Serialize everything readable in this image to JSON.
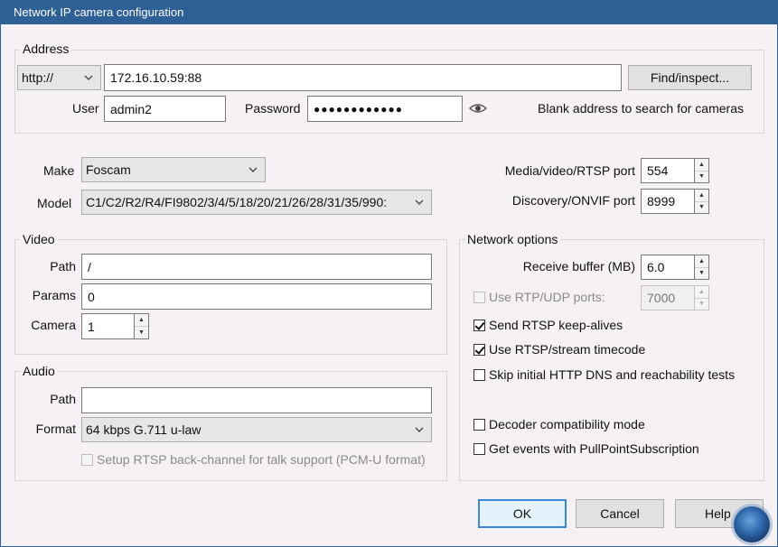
{
  "window": {
    "title": "Network IP camera configuration"
  },
  "address": {
    "legend": "Address",
    "protocol": "http://",
    "host": "172.16.10.59:88",
    "find_button": "Find/inspect...",
    "user_label": "User",
    "user": "admin2",
    "password_label": "Password",
    "password_mask": "●●●●●●●●●●●●",
    "hint": "Blank address to search for cameras"
  },
  "device": {
    "make_label": "Make",
    "make": "Foscam",
    "model_label": "Model",
    "model": "C1/C2/R2/R4/FI9802/3/4/5/18/20/21/26/28/31/35/990:"
  },
  "ports": {
    "media_label": "Media/video/RTSP port",
    "media": "554",
    "discovery_label": "Discovery/ONVIF port",
    "discovery": "8999"
  },
  "video": {
    "legend": "Video",
    "path_label": "Path",
    "path": "/",
    "params_label": "Params",
    "params": "0",
    "camera_label": "Camera",
    "camera": "1"
  },
  "audio": {
    "legend": "Audio",
    "path_label": "Path",
    "path": "",
    "format_label": "Format",
    "format": "64 kbps G.711 u-law",
    "backchannel": "Setup RTSP back-channel for talk support (PCM-U format)"
  },
  "network": {
    "legend": "Network options",
    "buffer_label": "Receive buffer (MB)",
    "buffer": "6.0",
    "rtp_udp": "Use RTP/UDP ports:",
    "rtp_udp_value": "7000",
    "keepalives": "Send RTSP keep-alives",
    "timecode": "Use RTSP/stream timecode",
    "skip_dns": "Skip initial HTTP DNS and reachability tests",
    "decoder_compat": "Decoder compatibility mode",
    "pullpoint": "Get events with PullPointSubscription"
  },
  "buttons": {
    "ok": "OK",
    "cancel": "Cancel",
    "help": "Help"
  },
  "colors": {
    "titlebar": "#2e5f95",
    "background": "#f5f1f5",
    "default_button_border": "#3c86d8"
  }
}
